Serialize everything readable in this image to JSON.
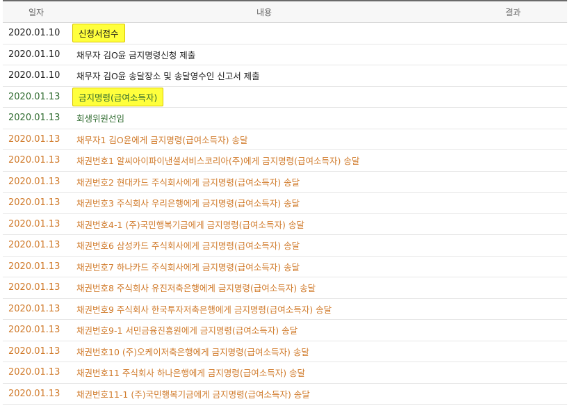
{
  "header": {
    "date": "일자",
    "content": "내용",
    "result": "결과"
  },
  "rows": [
    {
      "date": "2020.01.10",
      "content": "신청서접수",
      "result": ""
    },
    {
      "date": "2020.01.10",
      "content": "채무자 김O윤 금지명령신청 제출",
      "result": ""
    },
    {
      "date": "2020.01.10",
      "content": "채무자 김O윤 송달장소 및 송달영수인 신고서 제출",
      "result": ""
    },
    {
      "date": "2020.01.13",
      "content": "금지명령(급여소득자)",
      "result": ""
    },
    {
      "date": "2020.01.13",
      "content": "회생위원선임",
      "result": ""
    },
    {
      "date": "2020.01.13",
      "content": "채무자1 김O윤에게 금지명령(급여소득자) 송달",
      "result": ""
    },
    {
      "date": "2020.01.13",
      "content": "채권번호1 알씨아이파이낸셜서비스코리아(주)에게 금지명령(급여소득자) 송달",
      "result": ""
    },
    {
      "date": "2020.01.13",
      "content": "채권번호2 현대카드 주식회사에게 금지명령(급여소득자) 송달",
      "result": ""
    },
    {
      "date": "2020.01.13",
      "content": "채권번호3 주식회사 우리은행에게 금지명령(급여소득자) 송달",
      "result": ""
    },
    {
      "date": "2020.01.13",
      "content": "채권번호4-1 (주)국민행복기금에게 금지명령(급여소득자) 송달",
      "result": ""
    },
    {
      "date": "2020.01.13",
      "content": "채권번호6 삼성카드 주식회사에게 금지명령(급여소득자) 송달",
      "result": ""
    },
    {
      "date": "2020.01.13",
      "content": "채권번호7 하나카드 주식회사에게 금지명령(급여소득자) 송달",
      "result": ""
    },
    {
      "date": "2020.01.13",
      "content": "채권번호8 주식회사 유진저축은행에게 금지명령(급여소득자) 송달",
      "result": ""
    },
    {
      "date": "2020.01.13",
      "content": "채권번호9 주식회사 한국투자저축은행에게 금지명령(급여소득자) 송달",
      "result": ""
    },
    {
      "date": "2020.01.13",
      "content": "채권번호9-1 서민금융진흥원에게 금지명령(급여소득자) 송달",
      "result": ""
    },
    {
      "date": "2020.01.13",
      "content": "채권번호10 (주)오케이저축은행에게 금지명령(급여소득자) 송달",
      "result": ""
    },
    {
      "date": "2020.01.13",
      "content": "채권번호11 주식회사 하나은행에게 금지명령(급여소득자) 송달",
      "result": ""
    },
    {
      "date": "2020.01.13",
      "content": "채권번호11-1 (주)국민행복기금에게 금지명령(급여소득자) 송달",
      "result": ""
    }
  ],
  "colors": {
    "filed_text": "#1f1f1f",
    "order_text": "#2f6b2f",
    "service_text": "#d07a2a",
    "highlight": "#ffff3c"
  }
}
